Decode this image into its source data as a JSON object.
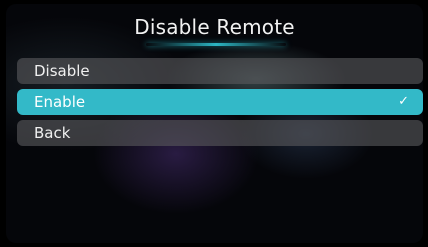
{
  "header": {
    "title": "Disable Remote"
  },
  "menu": {
    "items": [
      {
        "label": "Disable",
        "selected": false
      },
      {
        "label": "Enable",
        "selected": true
      },
      {
        "label": "Back",
        "selected": false
      }
    ],
    "selected_mark": "✓"
  },
  "colors": {
    "accent": "#33b9c8",
    "item_background": "#58585c",
    "text": "#f0f0f0"
  },
  "icons": {
    "selected": "check-icon"
  }
}
